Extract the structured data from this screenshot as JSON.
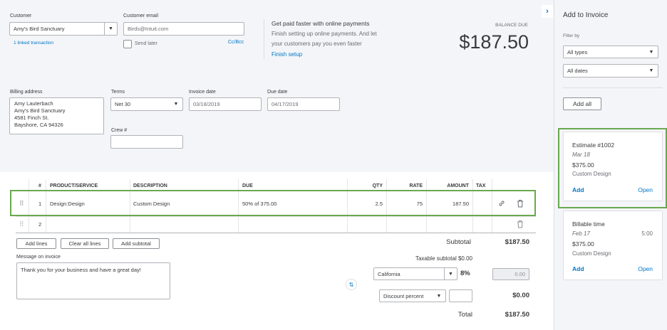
{
  "customer": {
    "label": "Customer",
    "value": "Amy's Bird Sanctuary",
    "linked": "1 linked transaction"
  },
  "email": {
    "label": "Customer email",
    "value": "Birds@Intuit.com",
    "send_later": "Send later",
    "cc_bcc": "Cc/Bcc"
  },
  "promo": {
    "title": "Get paid faster with online payments",
    "body1": "Finish setting up online payments. And let",
    "body2": "your customers pay you even faster",
    "link": "Finish setup"
  },
  "balance": {
    "label": "BALANCE DUE",
    "amount": "$187.50"
  },
  "billing": {
    "label": "Billing address",
    "lines": [
      "Amy Lauterbach",
      "Amy's Bird Sanctuary",
      "4581 Finch St.",
      "Bayshore, CA  94326"
    ]
  },
  "terms": {
    "label": "Terms",
    "value": "Net 30"
  },
  "invoice_date": {
    "label": "Invoice date",
    "value": "03/18/2019"
  },
  "due_date": {
    "label": "Due date",
    "value": "04/17/2019"
  },
  "crew": {
    "label": "Crew #",
    "value": ""
  },
  "table": {
    "headers": [
      "#",
      "PRODUCT/SERVICE",
      "DESCRIPTION",
      "DUE",
      "QTY",
      "RATE",
      "AMOUNT",
      "TAX"
    ],
    "row1": {
      "num": "1",
      "product": "Design:Design",
      "description": "Custom Design",
      "due": "50% of 375.00",
      "qty": "2.5",
      "rate": "75",
      "amount": "187.50"
    },
    "row2": {
      "num": "2"
    }
  },
  "buttons": {
    "add_lines": "Add lines",
    "clear_lines": "Clear all lines",
    "add_subtotal": "Add subtotal"
  },
  "message": {
    "label": "Message on invoice",
    "value": "Thank you for your business and have a great day!"
  },
  "totals": {
    "subtotal_label": "Subtotal",
    "subtotal": "$187.50",
    "taxable_label": "Taxable subtotal $0.00",
    "tax_region": "California",
    "tax_rate": "8%",
    "tax_amount": "0.00",
    "discount_type": "Discount percent",
    "discount_value": "$0.00",
    "total_label": "Total",
    "total": "$187.50"
  },
  "panel": {
    "title": "Add to Invoice",
    "filter_label": "Filter by",
    "type_filter": "All types",
    "date_filter": "All dates",
    "add_all": "Add all",
    "estimate": {
      "title": "Estimate #1002",
      "date": "Mar 18",
      "amount": "$375.00",
      "desc": "Custom Design",
      "add": "Add",
      "open": "Open"
    },
    "billable": {
      "title": "Billable time",
      "date": "Feb 17",
      "hours": "5:00",
      "amount": "$375.00",
      "desc": "Custom Design",
      "add": "Add",
      "open": "Open"
    }
  },
  "colors": {
    "accent": "#0077c5",
    "highlight": "#6aa84f",
    "panel_bg": "#f4f5f8"
  }
}
